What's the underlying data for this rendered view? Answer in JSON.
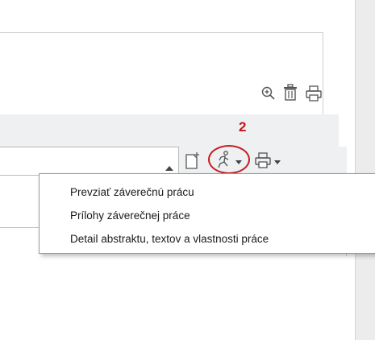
{
  "step_badge": "2",
  "menu": {
    "items": [
      {
        "label": "Prevziať  záverečnú prácu"
      },
      {
        "label": "Prílohy záverečnej práce"
      },
      {
        "label": "Detail abstraktu, textov a vlastnosti práce"
      }
    ]
  },
  "icons": {
    "zoom": "zoom-in-icon",
    "trash": "trash-icon",
    "print": "printer-icon",
    "new_doc": "new-document-icon",
    "runner": "runner-icon",
    "sort": "sort-caret-icon"
  },
  "colors": {
    "annotation_red": "#c41c22",
    "toolbar_gray": "#eef0f1"
  }
}
